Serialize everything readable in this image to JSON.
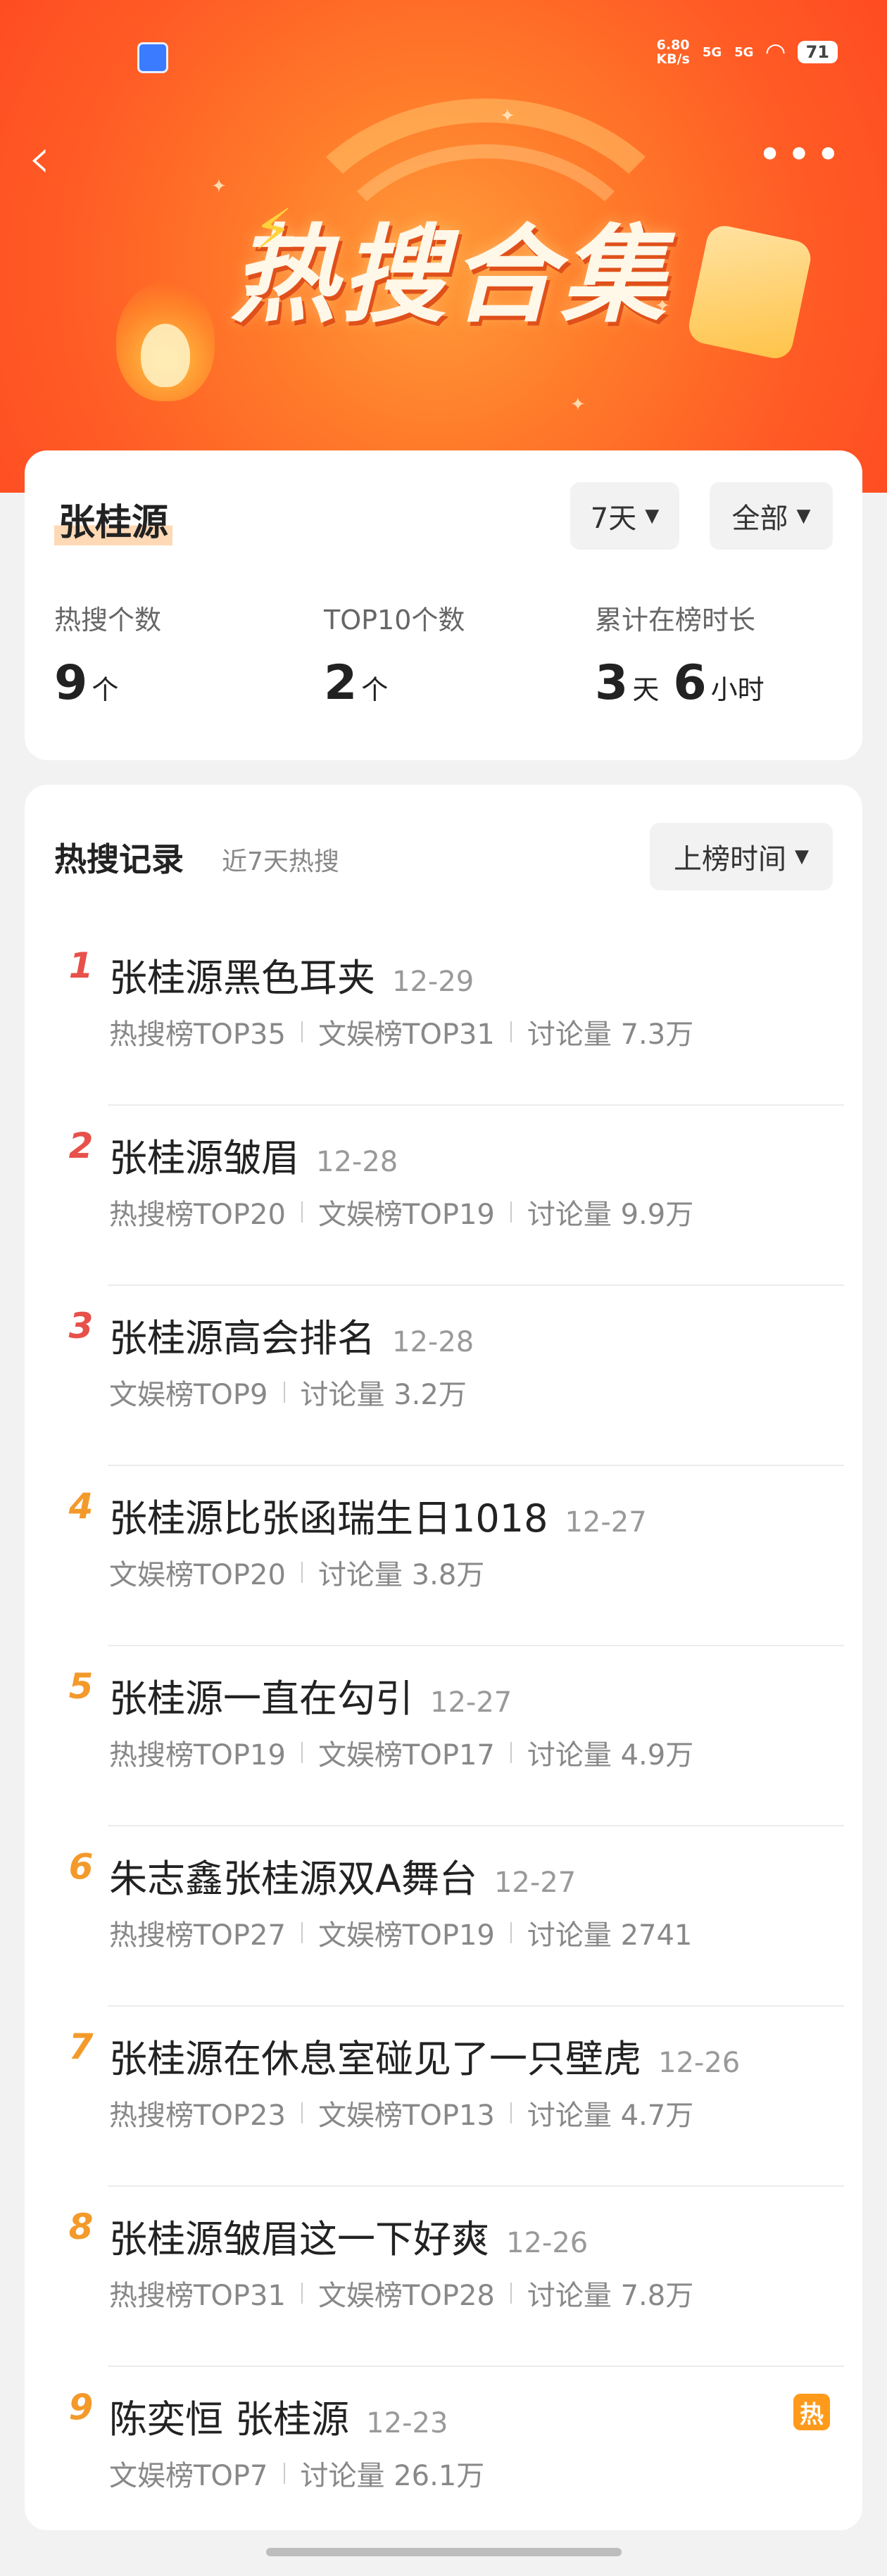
{
  "status_bar": {
    "speed": "6.80",
    "speed_unit": "KB/s",
    "net1": "5G",
    "net2": "5G",
    "battery": "71"
  },
  "header": {
    "title": "热搜合集"
  },
  "summary": {
    "name": "张桂源",
    "filter_days": "7天",
    "filter_scope": "全部",
    "stats": [
      {
        "label": "热搜个数",
        "parts": [
          {
            "num": "9",
            "unit": "个"
          }
        ]
      },
      {
        "label": "TOP10个数",
        "parts": [
          {
            "num": "2",
            "unit": "个"
          }
        ]
      },
      {
        "label": "累计在榜时长",
        "parts": [
          {
            "num": "3",
            "unit": "天"
          },
          {
            "num": "6",
            "unit": "小时"
          }
        ]
      }
    ]
  },
  "records": {
    "title": "热搜记录",
    "subtitle": "近7天热搜",
    "sort_label": "上榜时间",
    "items": [
      {
        "rank": "1",
        "title": "张桂源黑色耳夹",
        "date": "12-29",
        "meta": [
          "热搜榜TOP35",
          "文娱榜TOP31",
          "讨论量 7.3万"
        ]
      },
      {
        "rank": "2",
        "title": "张桂源皱眉",
        "date": "12-28",
        "meta": [
          "热搜榜TOP20",
          "文娱榜TOP19",
          "讨论量 9.9万"
        ]
      },
      {
        "rank": "3",
        "title": "张桂源高会排名",
        "date": "12-28",
        "meta": [
          "文娱榜TOP9",
          "讨论量 3.2万"
        ]
      },
      {
        "rank": "4",
        "title": "张桂源比张函瑞生日1018",
        "date": "12-27",
        "meta": [
          "文娱榜TOP20",
          "讨论量 3.8万"
        ]
      },
      {
        "rank": "5",
        "title": "张桂源一直在勾引",
        "date": "12-27",
        "meta": [
          "热搜榜TOP19",
          "文娱榜TOP17",
          "讨论量 4.9万"
        ]
      },
      {
        "rank": "6",
        "title": "朱志鑫张桂源双A舞台",
        "date": "12-27",
        "meta": [
          "热搜榜TOP27",
          "文娱榜TOP19",
          "讨论量 2741"
        ]
      },
      {
        "rank": "7",
        "title": "张桂源在休息室碰见了一只壁虎",
        "date": "12-26",
        "meta": [
          "热搜榜TOP23",
          "文娱榜TOP13",
          "讨论量 4.7万"
        ]
      },
      {
        "rank": "8",
        "title": "张桂源皱眉这一下好爽",
        "date": "12-26",
        "meta": [
          "热搜榜TOP31",
          "文娱榜TOP28",
          "讨论量 7.8万"
        ]
      },
      {
        "rank": "9",
        "title": "陈奕恒 张桂源",
        "date": "12-23",
        "meta": [
          "文娱榜TOP7",
          "讨论量 26.1万"
        ],
        "badge": "热"
      }
    ]
  },
  "colors": {
    "rank_top": "#e8504a",
    "rank_mid": "#f39a2b",
    "badge": "#ff9a1a",
    "accent": "#ff5c25"
  },
  "icons": {
    "back": "back-arrow-icon",
    "more": "more-dots-icon",
    "caret": "caret-down-icon"
  }
}
